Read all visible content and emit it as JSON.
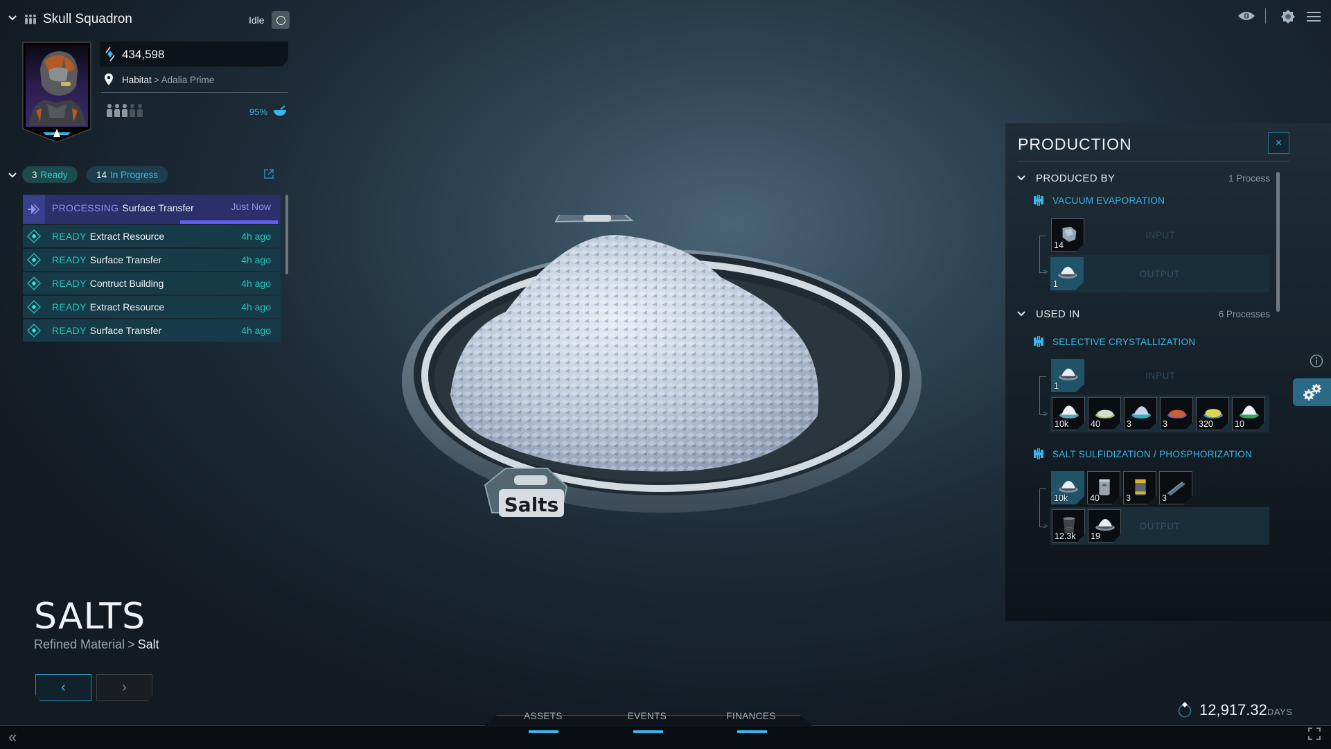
{
  "crew": {
    "name": "Skull Squadron",
    "status": "Idle",
    "credits": "434,598",
    "location_primary": "Habitat",
    "location_separator": ">",
    "location_secondary": "Adalia Prime",
    "crew_slots_filled": 3,
    "crew_slots_total": 5,
    "food_percent": "95%"
  },
  "actions": {
    "ready_count": "3",
    "ready_label": "Ready",
    "progress_count": "14",
    "progress_label": "In Progress",
    "items": [
      {
        "status": "PROCESSING",
        "name": "Surface Transfer",
        "time": "Just Now",
        "progress": 0.38
      },
      {
        "status": "READY",
        "name": "Extract Resource",
        "time": "4h ago"
      },
      {
        "status": "READY",
        "name": "Surface Transfer",
        "time": "4h ago"
      },
      {
        "status": "READY",
        "name": "Contruct Building",
        "time": "4h ago"
      },
      {
        "status": "READY",
        "name": "Extract Resource",
        "time": "4h ago"
      },
      {
        "status": "READY",
        "name": "Surface Transfer",
        "time": "4h ago"
      }
    ]
  },
  "material": {
    "title": "SALTS",
    "category": "Refined Material",
    "separator": ">",
    "subcategory": "Salt",
    "label_on_tray": "Salts"
  },
  "production": {
    "title": "PRODUCTION",
    "close_label": "×",
    "produced_by": {
      "label": "PRODUCED BY",
      "count": "1 Process",
      "processes": [
        {
          "name": "VACUUM EVAPORATION",
          "input_label": "INPUT",
          "output_label": "OUTPUT",
          "inputs": [
            {
              "qty": "14",
              "kind": "crystal"
            }
          ],
          "outputs": [
            {
              "qty": "1",
              "kind": "salt",
              "highlight": true
            }
          ]
        }
      ]
    },
    "used_in": {
      "label": "USED IN",
      "count": "6 Processes",
      "processes": [
        {
          "name": "SELECTIVE CRYSTALLIZATION",
          "input_label": "INPUT",
          "inputs": [
            {
              "qty": "1",
              "kind": "salt",
              "highlight": true
            }
          ],
          "outputs": [
            {
              "qty": "10k",
              "kind": "salt-white"
            },
            {
              "qty": "40",
              "kind": "salt-granular"
            },
            {
              "qty": "3",
              "kind": "salt-blue"
            },
            {
              "qty": "3",
              "kind": "salt-orange"
            },
            {
              "qty": "320",
              "kind": "salt-yellow"
            },
            {
              "qty": "10",
              "kind": "salt-green"
            }
          ]
        },
        {
          "name": "SALT SULFIDIZATION / PHOSPHORIZATION",
          "output_label": "OUTPUT",
          "inputs": [
            {
              "qty": "10k",
              "kind": "salt",
              "highlight": true
            },
            {
              "qty": "40",
              "kind": "canister-grey"
            },
            {
              "qty": "3",
              "kind": "canister-yellow"
            },
            {
              "qty": "3",
              "kind": "beam"
            }
          ],
          "outputs": [
            {
              "qty": "12.3k",
              "kind": "bucket"
            },
            {
              "qty": "19",
              "kind": "salt"
            }
          ]
        }
      ]
    }
  },
  "bottom_tabs": [
    {
      "label": "ASSETS"
    },
    {
      "label": "EVENTS"
    },
    {
      "label": "FINANCES"
    }
  ],
  "clock": {
    "value": "12,917.32",
    "unit": "DAYS"
  },
  "colors": {
    "accent": "#3ab7ea",
    "ready": "#24c6b9",
    "processing": "#8d92ef",
    "progress_bar": "#5e5ff0"
  }
}
